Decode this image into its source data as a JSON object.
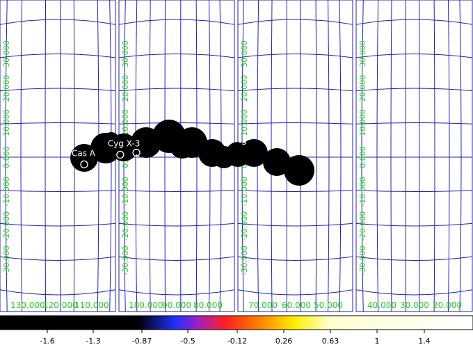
{
  "colors": {
    "background": "#ffffff",
    "panel_background": "#ffffff",
    "grid_line": "#2020b0",
    "grid_label": "#22cc22",
    "source_fill": "#000000",
    "marker_color": "#ffffff",
    "source_label": "#ffffff"
  },
  "panels": [
    {
      "lon_labels": [
        "130.000",
        "120.000",
        "110.000"
      ],
      "lat_labels": [
        "30.000",
        "20.000",
        "10.000",
        "0.000",
        "-10.000",
        "-20.000",
        "-30.000"
      ]
    },
    {
      "lon_labels": [
        "100.000",
        "90.000",
        "80.000"
      ],
      "lat_labels": [
        "30.000",
        "20.000",
        "10.000",
        "0.000",
        "-10.000",
        "-20.000",
        "-30.000"
      ]
    },
    {
      "lon_labels": [
        "70.000",
        "60.000",
        "50.000"
      ],
      "lat_labels": [
        "30.000",
        "20.000",
        "10.000",
        "0.000",
        "-10.000",
        "-20.000",
        "-30.000"
      ]
    },
    {
      "lon_labels": [
        "40.000",
        "30.000",
        "20.000"
      ],
      "lat_labels": [
        "30.000",
        "20.000",
        "10.000",
        "0.000",
        "-10.000",
        "-20.000",
        "-30.000"
      ]
    }
  ],
  "sources": [
    {
      "label": "Cas A",
      "lon": 111.7,
      "lat": -2.1
    },
    {
      "label": "Cyg X-3",
      "lon": 79.8,
      "lat": 0.7
    },
    {
      "label": "",
      "lon": 65.5,
      "lat": 1.3
    }
  ],
  "source_fragment_label": "-3",
  "colorbar": {
    "colormap": "heat",
    "tick_labels": [
      "-1.6",
      "-1.3",
      "-0.87",
      "-0.5",
      "-0.12",
      "0.26",
      "0.63",
      "1",
      "1.4"
    ],
    "stops": [
      {
        "value": -1.6,
        "color": "#000000"
      },
      {
        "value": -0.87,
        "color": "#000000"
      },
      {
        "value": -0.58,
        "color": "#2030ff"
      },
      {
        "value": -0.4,
        "color": "#a020c0"
      },
      {
        "value": -0.18,
        "color": "#ff2020"
      },
      {
        "value": 0.12,
        "color": "#ff9000"
      },
      {
        "value": 0.35,
        "color": "#ffee00"
      },
      {
        "value": 0.63,
        "color": "#ffffd0"
      },
      {
        "value": 1.7,
        "color": "#ffffff"
      }
    ],
    "range": [
      -1.95,
      1.75
    ]
  }
}
